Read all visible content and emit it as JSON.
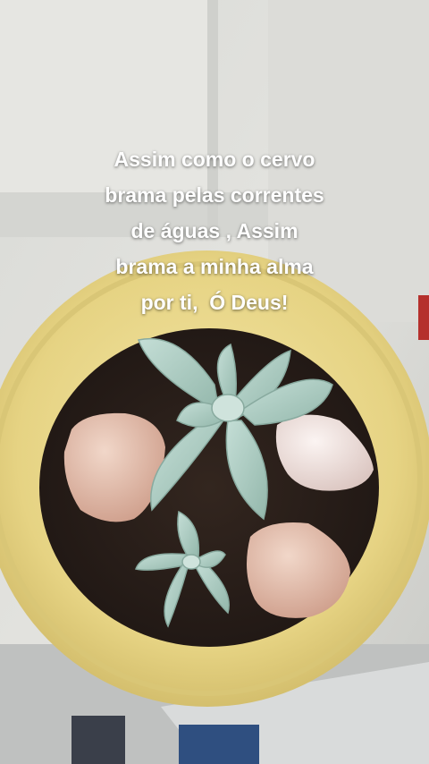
{
  "story": {
    "caption_lines": [
      "Assim como o cervo",
      "brama pelas correntes",
      "de águas , Assim",
      "brama a minha alma",
      "por ti,  Ó Deus!"
    ]
  },
  "colors": {
    "text": "#ffffff",
    "pot": "#e8d68a",
    "soil": "#2a1f1a",
    "leaf": "#a9c7bd",
    "stone": "#e6c3b4"
  }
}
